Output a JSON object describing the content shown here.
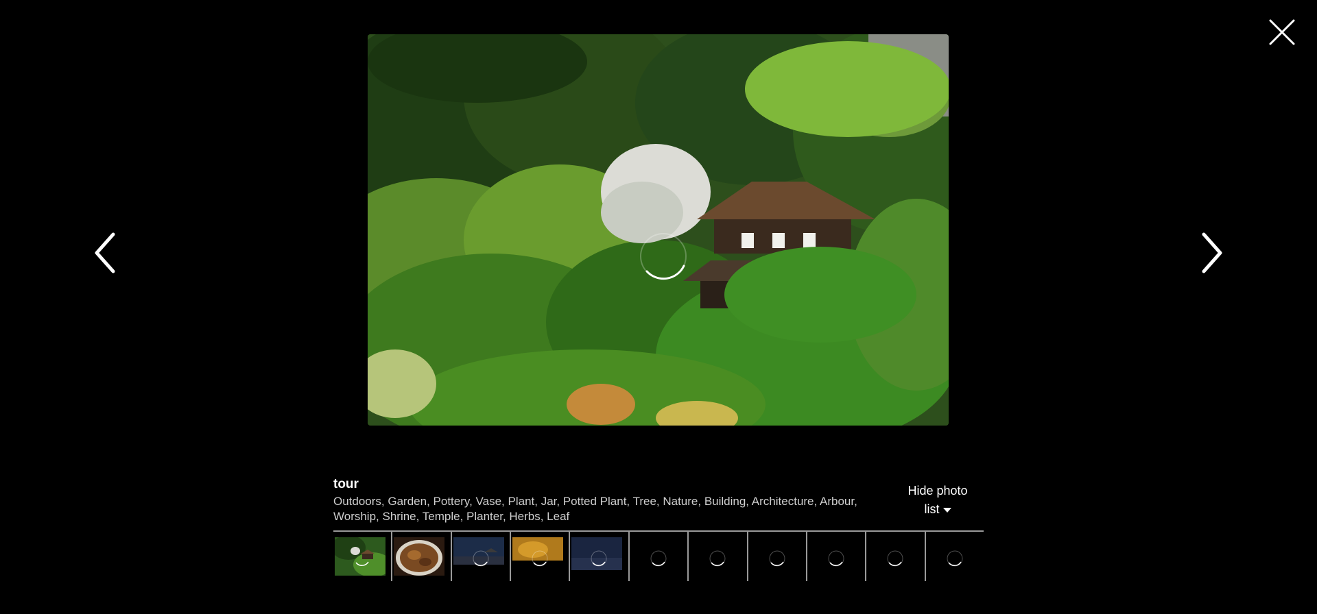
{
  "viewer": {
    "close_icon": "close-icon",
    "prev_icon": "chevron-left-icon",
    "next_icon": "chevron-right-icon"
  },
  "photo": {
    "title": "tour",
    "tags": "Outdoors, Garden, Pottery, Vase, Plant, Jar, Potted Plant, Tree, Nature, Building, Architecture, Arbour, Worship, Shrine, Temple, Planter, Herbs, Leaf",
    "loading": true
  },
  "photo_list": {
    "toggle_label_line1": "Hide photo",
    "toggle_label_line2": "list",
    "toggle_icon": "caret-down-icon",
    "thumbnails": [
      {
        "kind": "garden",
        "loaded": true,
        "selected": true
      },
      {
        "kind": "food",
        "loaded": true
      },
      {
        "kind": "night-temple",
        "loaded": false
      },
      {
        "kind": "autumn",
        "loaded": false
      },
      {
        "kind": "sea-dusk",
        "loaded": false
      },
      {
        "kind": "blank",
        "loaded": false
      },
      {
        "kind": "blank",
        "loaded": false
      },
      {
        "kind": "blank",
        "loaded": false
      },
      {
        "kind": "blank",
        "loaded": false
      },
      {
        "kind": "blank",
        "loaded": false
      },
      {
        "kind": "blank",
        "loaded": false
      }
    ]
  },
  "colors": {
    "background": "#000000",
    "text": "#ffffff",
    "tags_text": "#cfcfcf",
    "divider": "#9a9a9a"
  }
}
